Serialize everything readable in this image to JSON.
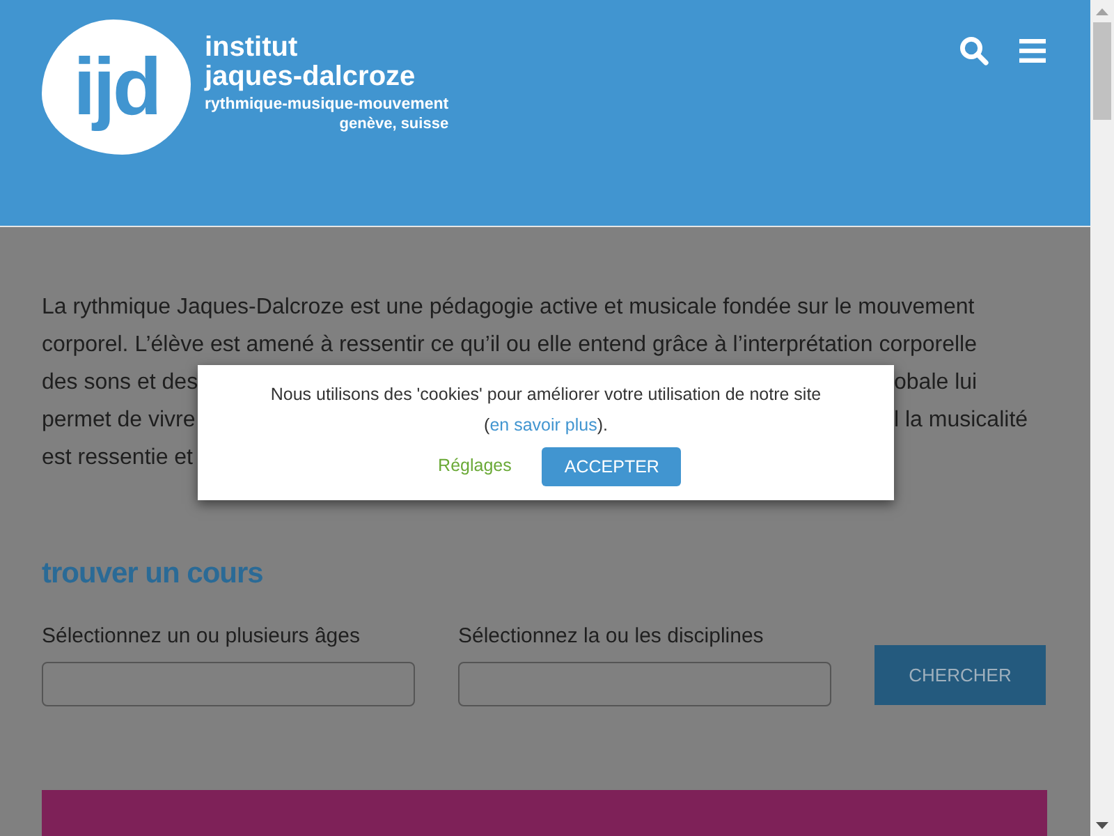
{
  "header": {
    "logo_mark": "ijd",
    "logo_lines": [
      "institut",
      "jaques-dalcroze",
      "rythmique-musique-mouvement",
      "genève, suisse"
    ]
  },
  "intro": {
    "lines": [
      {
        "left": "La rythmique Jaques-Dalcroze est une pédagogie active et musicale fondée sur le mouvement"
      },
      {
        "left": "corporel. L’élève est amené à ressentir ce qu’il ou elle entend grâce à l’interprétation corporelle"
      },
      {
        "left": "des sons et des",
        "right": "obale lui"
      },
      {
        "left": "permet de vivre",
        "right": "l la musicalité"
      },
      {
        "left": "est ressentie et"
      }
    ]
  },
  "course_finder": {
    "title": "trouver un cours",
    "fields": [
      {
        "label": "Sélectionnez un ou plusieurs âges"
      },
      {
        "label": "Sélectionnez la ou les disciplines"
      }
    ],
    "button": "CHERCHER"
  },
  "cookie_notice": {
    "text_before": "Nous utilisons des 'cookies' pour améliorer votre utilisation de notre site (",
    "link": "en savoir plus",
    "text_after": ").",
    "settings_link": "Réglages",
    "accept_button": "ACCEPTER"
  }
}
